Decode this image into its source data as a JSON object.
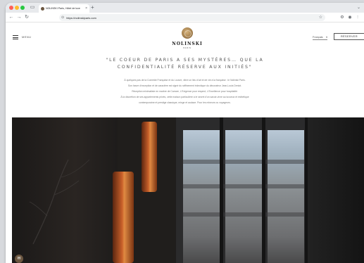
{
  "browser": {
    "tab": {
      "title": "NOLINSKI Paris, Hôtel de luxe",
      "close_icon": "×"
    },
    "new_tab_icon": "+",
    "tab_dropdown_icon": "⌄",
    "toolbar": {
      "back_icon": "←",
      "forward_icon": "→",
      "reload_icon": "↻",
      "url": "https://nolinskiparis.com",
      "star_icon": "☆",
      "extension_icons": [
        "⚙",
        "◉",
        "⫶"
      ]
    },
    "sidebar_icon": "▭"
  },
  "header": {
    "menu_label": "MENU",
    "logo": {
      "name": "NOLINSKI",
      "city": "PARIS"
    },
    "language": {
      "selected": "Français",
      "chevron": "∨"
    },
    "reserve_label": "RÉSERVER"
  },
  "main": {
    "headline": [
      "\"LE COEUR DE PARIS A SES MYSTÈRES… QUE LA",
      "CONFIDENTIALITÉ RÉSERVE AUX INITIÉS\""
    ],
    "intro": [
      "À quelques pas de la Comédie Française et du Louvre, vibre un lieu d'art et de vie à la française : le Nolinski Paris.",
      "Son havre d'exception et de caractère est signé du raffinement éclectique du décorateur Jean-Louis Deniot.",
      "Réception minimaliste en marbre de Carrare, L'Exigence pour respect, L'Excellence pour hospitalité.",
      "À la discrétion de ses appartements privés, cette maison particulière a le secret d'un savoir-vivre au luxueux et esthétique",
      "contemporaine et prestige classique, mixge et audace. Pour les mineurs ou voyageurs."
    ]
  },
  "hero": {
    "chat_icon": "✉"
  },
  "colors": {
    "accent": "#6b5640",
    "text_muted": "#777777"
  }
}
